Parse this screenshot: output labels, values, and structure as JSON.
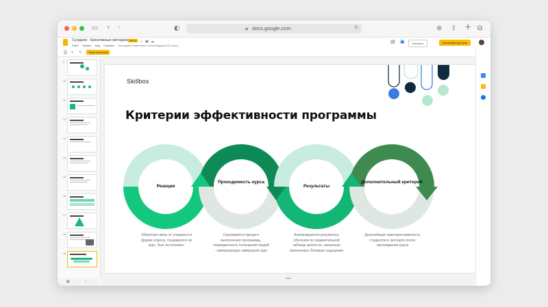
{
  "browser": {
    "url": "docs.google.com"
  },
  "docs": {
    "title": "Сундаев · Креативные методики",
    "badge": "PPTX",
    "menus": [
      "Файл",
      "Правка",
      "Вид",
      "Справка"
    ],
    "last_edit": "Последнее изменение: Анна Мирдина 00 minus",
    "view_button": "Смотреть",
    "share_button": "Настройки Доступа",
    "themes_button": "Темы принятия"
  },
  "filmstrip": {
    "slides": [
      {
        "num": "9"
      },
      {
        "num": "10"
      },
      {
        "num": "11"
      },
      {
        "num": "12"
      },
      {
        "num": "13"
      },
      {
        "num": "14"
      },
      {
        "num": "15"
      },
      {
        "num": "16"
      },
      {
        "num": "17"
      },
      {
        "num": "18"
      },
      {
        "num": "19"
      }
    ],
    "selected": 10
  },
  "slide": {
    "brand": "Skillbox",
    "title": "Критерии эффективности программы",
    "stages": [
      {
        "label": "Реакция",
        "description": "Обратная связь от учащихся в форме опроса: понравился ли курс, был ли полезен.",
        "ring_color": "#14c77f"
      },
      {
        "label": "Проходимость курса",
        "description": "Оценивается процент выполнения программы, периодичность посещения людей - завершающие завершили курс",
        "ring_color": "#0e8a57"
      },
      {
        "label": "Результаты",
        "description": "Анализируются результаты обучения по сравнительной таблице до/после, насколько изменились болевые ощущения",
        "ring_color": "#14b676"
      },
      {
        "label": "Дополнительный критерий",
        "description": "Дальнейшая заинтересованность студентов в эксперте после прохождения курса",
        "ring_color": "#3f8a4f"
      }
    ],
    "colors": {
      "pale_ring": "#c9ece0",
      "pale_ring_gray": "#dfe7e3",
      "decor_blue": "#3d7be0",
      "decor_navy": "#0f2b3d",
      "decor_mint": "#b7e8cf"
    }
  }
}
